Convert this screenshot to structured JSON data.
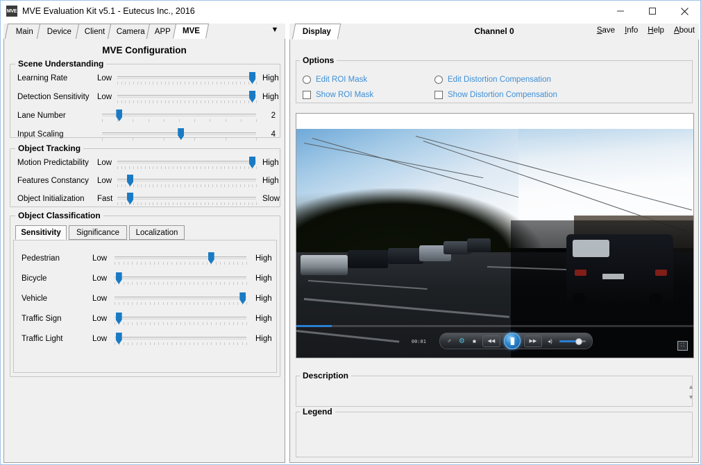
{
  "window": {
    "icon_label": "MVE",
    "title": "MVE Evaluation Kit v5.1 - Eutecus Inc., 2016",
    "minimize_icon": "minimize-icon",
    "maximize_icon": "maximize-icon",
    "close_icon": "close-icon"
  },
  "left_panel": {
    "tabs": [
      {
        "label": "Main",
        "active": false
      },
      {
        "label": "Device",
        "active": false
      },
      {
        "label": "Client",
        "active": false
      },
      {
        "label": "Camera",
        "active": false
      },
      {
        "label": "APP",
        "active": false
      },
      {
        "label": "MVE",
        "active": true
      }
    ],
    "tab_overflow_icon": "chevron-down-icon",
    "config_title": "MVE Configuration",
    "scene_understanding": {
      "label": "Scene Understanding",
      "rows": [
        {
          "label": "Learning Rate",
          "min": "Low",
          "max": "High",
          "value_pct": 97,
          "ticks": 35
        },
        {
          "label": "Detection Sensitivity",
          "min": "Low",
          "max": "High",
          "value_pct": 97,
          "ticks": 35
        },
        {
          "label": "Lane Number",
          "min": "",
          "max": "2",
          "value_pct": 11,
          "ticks": 10
        },
        {
          "label": "Input Scaling",
          "min": "",
          "max": "4",
          "value_pct": 51,
          "ticks": 5
        }
      ]
    },
    "object_tracking": {
      "label": "Object Tracking",
      "rows": [
        {
          "label": "Motion Predictability",
          "min": "Low",
          "max": "High",
          "value_pct": 97,
          "ticks": 35
        },
        {
          "label": "Features Constancy",
          "min": "Low",
          "max": "High",
          "value_pct": 9,
          "ticks": 35
        },
        {
          "label": "Object Initialization",
          "min": "Fast",
          "max": "Slow",
          "value_pct": 9,
          "ticks": 35
        }
      ]
    },
    "object_classification": {
      "label": "Object Classification",
      "tabs": [
        {
          "label": "Sensitivity",
          "active": true
        },
        {
          "label": "Significance",
          "active": false
        },
        {
          "label": "Localization",
          "active": false
        }
      ],
      "rows": [
        {
          "label": "Pedestrian",
          "min": "Low",
          "max": "High",
          "value_pct": 73,
          "ticks": 30
        },
        {
          "label": "Bicycle",
          "min": "Low",
          "max": "High",
          "value_pct": 3,
          "ticks": 30
        },
        {
          "label": "Vehicle",
          "min": "Low",
          "max": "High",
          "value_pct": 97,
          "ticks": 30
        },
        {
          "label": "Traffic Sign",
          "min": "Low",
          "max": "High",
          "value_pct": 3,
          "ticks": 30
        },
        {
          "label": "Traffic Light",
          "min": "Low",
          "max": "High",
          "value_pct": 3,
          "ticks": 30
        }
      ]
    }
  },
  "right_panel": {
    "tab_label": "Display",
    "channel_label": "Channel 0",
    "menu_items": [
      {
        "mnemonic": "S",
        "rest": "ave"
      },
      {
        "mnemonic": "I",
        "rest": "nfo"
      },
      {
        "mnemonic": "H",
        "rest": "elp"
      },
      {
        "mnemonic": "A",
        "rest": "bout"
      }
    ],
    "options": {
      "label": "Options",
      "items": [
        {
          "type": "radio",
          "label": "Edit ROI Mask",
          "checked": false
        },
        {
          "type": "radio",
          "label": "Edit Distortion Compensation",
          "checked": false
        },
        {
          "type": "checkbox",
          "label": "Show ROI Mask",
          "checked": false
        },
        {
          "type": "checkbox",
          "label": "Show Distortion Compensation",
          "checked": false
        }
      ]
    },
    "player": {
      "time": "00:01",
      "progress_pct": 9,
      "volume_pct": 62,
      "buttons": [
        {
          "name": "branch-icon",
          "glyph": "⑂"
        },
        {
          "name": "settings-icon",
          "glyph": "⚙"
        },
        {
          "name": "stop-icon",
          "glyph": "■"
        },
        {
          "name": "rewind-icon",
          "glyph": "◀◀"
        },
        {
          "name": "pause-icon",
          "glyph": "▐▌"
        },
        {
          "name": "fast-forward-icon",
          "glyph": "▶▶"
        },
        {
          "name": "volume-icon",
          "glyph": "◂)"
        }
      ],
      "fullscreen_icon": "fullscreen-icon"
    },
    "description": {
      "label": "Description",
      "text": ""
    },
    "legend": {
      "label": "Legend",
      "text": ""
    },
    "scroll_up_icon": "scroll-up-icon",
    "scroll_down_icon": "scroll-down-icon"
  },
  "colors": {
    "accent": "#1a7bc4",
    "link_blue": "#3d8fd6",
    "panel_bg": "#f0f0f0",
    "border": "#a0a0a0"
  }
}
